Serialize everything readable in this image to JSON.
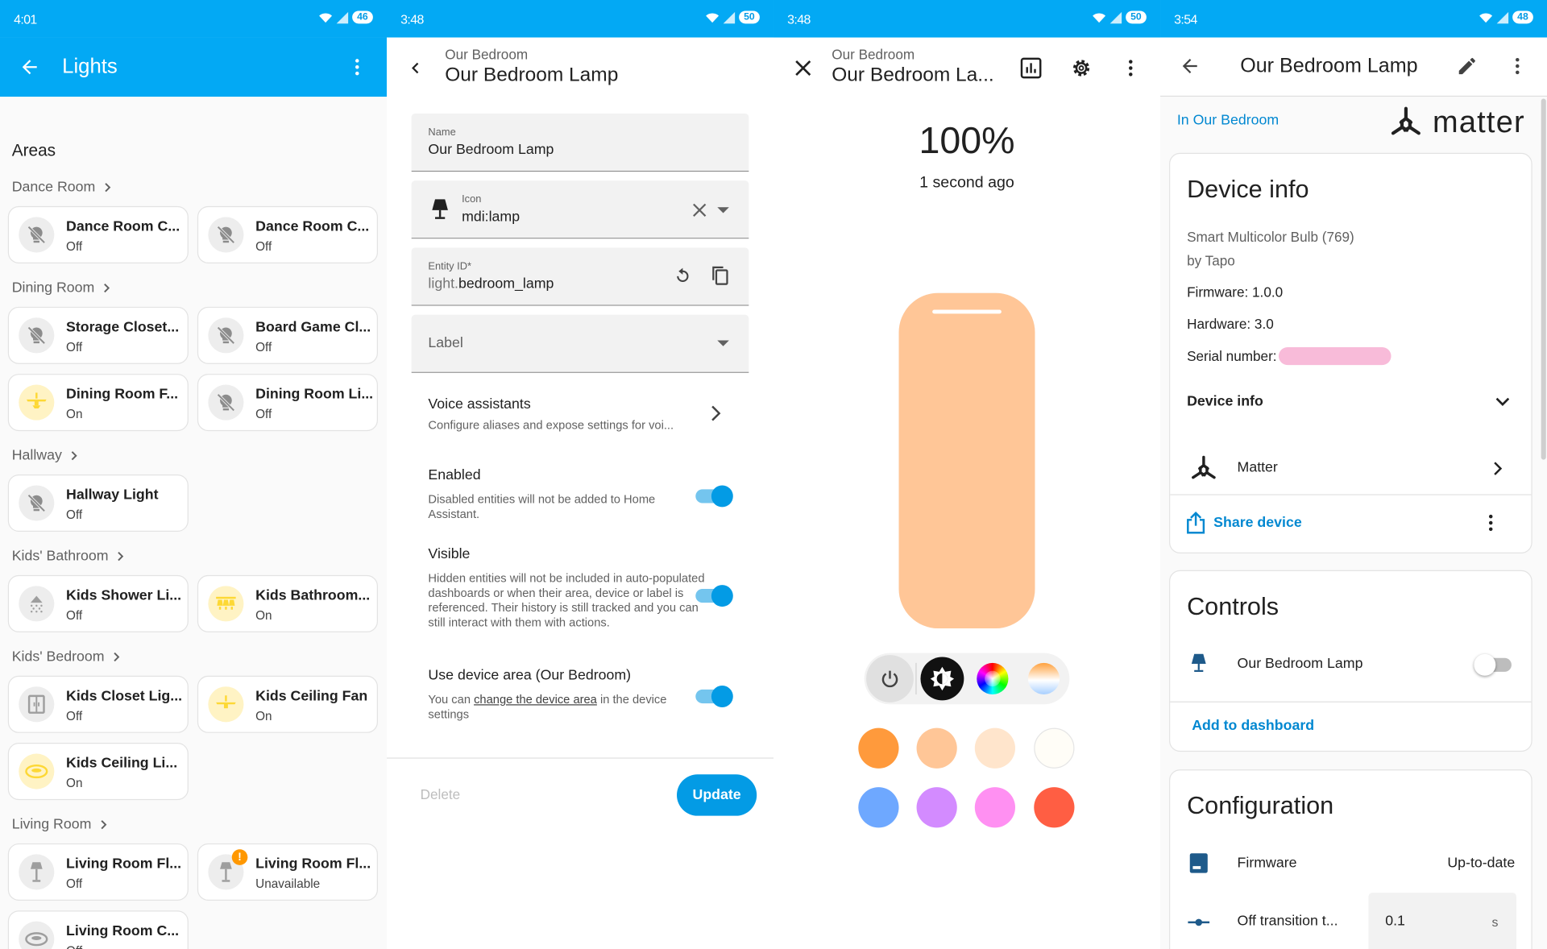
{
  "p1": {
    "time": "4:01",
    "battery": "46",
    "title": "Lights",
    "areas_label": "Areas",
    "groups": [
      {
        "name": "Dance Room"
      },
      {
        "name": "Dining Room"
      },
      {
        "name": "Hallway"
      },
      {
        "name": "Kids' Bathroom"
      },
      {
        "name": "Kids' Bedroom"
      },
      {
        "name": "Living Room"
      }
    ],
    "cards": [
      {
        "name": "Dance Room C...",
        "state": "Off",
        "icon": "lightbulb-off-icon"
      },
      {
        "name": "Dance Room C...",
        "state": "Off",
        "icon": "lightbulb-off-icon"
      },
      {
        "name": "Storage Closet...",
        "state": "Off",
        "icon": "lightbulb-off-icon"
      },
      {
        "name": "Board Game Cl...",
        "state": "Off",
        "icon": "lightbulb-off-icon"
      },
      {
        "name": "Dining Room F...",
        "state": "On",
        "icon": "ceiling-fan-light-icon"
      },
      {
        "name": "Dining Room Li...",
        "state": "Off",
        "icon": "lightbulb-off-icon"
      },
      {
        "name": "Hallway Light",
        "state": "Off",
        "icon": "lightbulb-off-icon"
      },
      {
        "name": "Kids Shower Li...",
        "state": "Off",
        "icon": "shower-light-icon"
      },
      {
        "name": "Kids Bathroom...",
        "state": "On",
        "icon": "vanity-light-icon"
      },
      {
        "name": "Kids Closet Lig...",
        "state": "Off",
        "icon": "closet-icon"
      },
      {
        "name": "Kids Ceiling Fan",
        "state": "On",
        "icon": "ceiling-fan-icon"
      },
      {
        "name": "Kids Ceiling Li...",
        "state": "On",
        "icon": "ceiling-light-icon"
      },
      {
        "name": "Living Room Fl...",
        "state": "Off",
        "icon": "floor-lamp-icon"
      },
      {
        "name": "Living Room Fl...",
        "state": "Unavailable",
        "icon": "floor-lamp-icon",
        "badge": "!"
      },
      {
        "name": "Living Room C...",
        "state": "Off",
        "icon": "ceiling-light-icon"
      }
    ]
  },
  "p2": {
    "time": "3:48",
    "battery": "50",
    "subtitle": "Our Bedroom",
    "title": "Our Bedroom Lamp",
    "name_label": "Name",
    "name_value": "Our Bedroom Lamp",
    "icon_label": "Icon",
    "icon_value": "mdi:lamp",
    "entity_label": "Entity ID*",
    "entity_prefix": "light.",
    "entity_value": "bedroom_lamp",
    "label_placeholder": "Label",
    "voice_title": "Voice assistants",
    "voice_sub": "Configure aliases and expose settings for voi...",
    "enabled_title": "Enabled",
    "enabled_desc": "Disabled entities will not be added to Home Assistant.",
    "enabled": true,
    "visible_title": "Visible",
    "visible_desc": "Hidden entities will not be included in auto-populated dashboards or when their area, device or label is referenced. Their history is still tracked and you can still interact with them with actions.",
    "visible": true,
    "area_title": "Use device area (Our Bedroom)",
    "area_desc_a": "You can ",
    "area_link": "change the device area",
    "area_desc_b": " in the device settings",
    "use_area": true,
    "delete": "Delete",
    "update": "Update"
  },
  "p3": {
    "time": "3:48",
    "battery": "50",
    "subtitle": "Our Bedroom",
    "title": "Our Bedroom La...",
    "brightness": "100%",
    "brightness_value": 100,
    "updated": "1 second ago",
    "slider_color": "#ffc697",
    "swatches": [
      "#ff9a3c",
      "#ffc697",
      "#ffe5cc",
      "#fffdf7",
      "#6ea8ff",
      "#d38bff",
      "#ff90f2",
      "#ff5e43"
    ]
  },
  "p4": {
    "time": "3:54",
    "battery": "48",
    "title": "Our Bedroom Lamp",
    "area_link": "In Our Bedroom",
    "brand": "matter",
    "device_info_title": "Device info",
    "model": "Smart Multicolor Bulb (769)",
    "maker": "by Tapo",
    "firmware": "Firmware: 1.0.0",
    "hardware": "Hardware: 3.0",
    "serial": "Serial number:",
    "device_info_toggle": "Device info",
    "integration": "Matter",
    "share": "Share device",
    "controls_title": "Controls",
    "control_entity": "Our Bedroom Lamp",
    "control_on": false,
    "add_dashboard": "Add to dashboard",
    "config_title": "Configuration",
    "cfg_firmware": "Firmware",
    "cfg_firmware_value": "Up-to-date",
    "cfg_off_transition": "Off transition t...",
    "cfg_off_value": "0.1",
    "cfg_off_unit": "s"
  },
  "colors": {
    "accent": "#03a9f4",
    "primary": "#039be5",
    "on_icon": "#fdd835",
    "serial_redact": "#f8bbd9"
  }
}
